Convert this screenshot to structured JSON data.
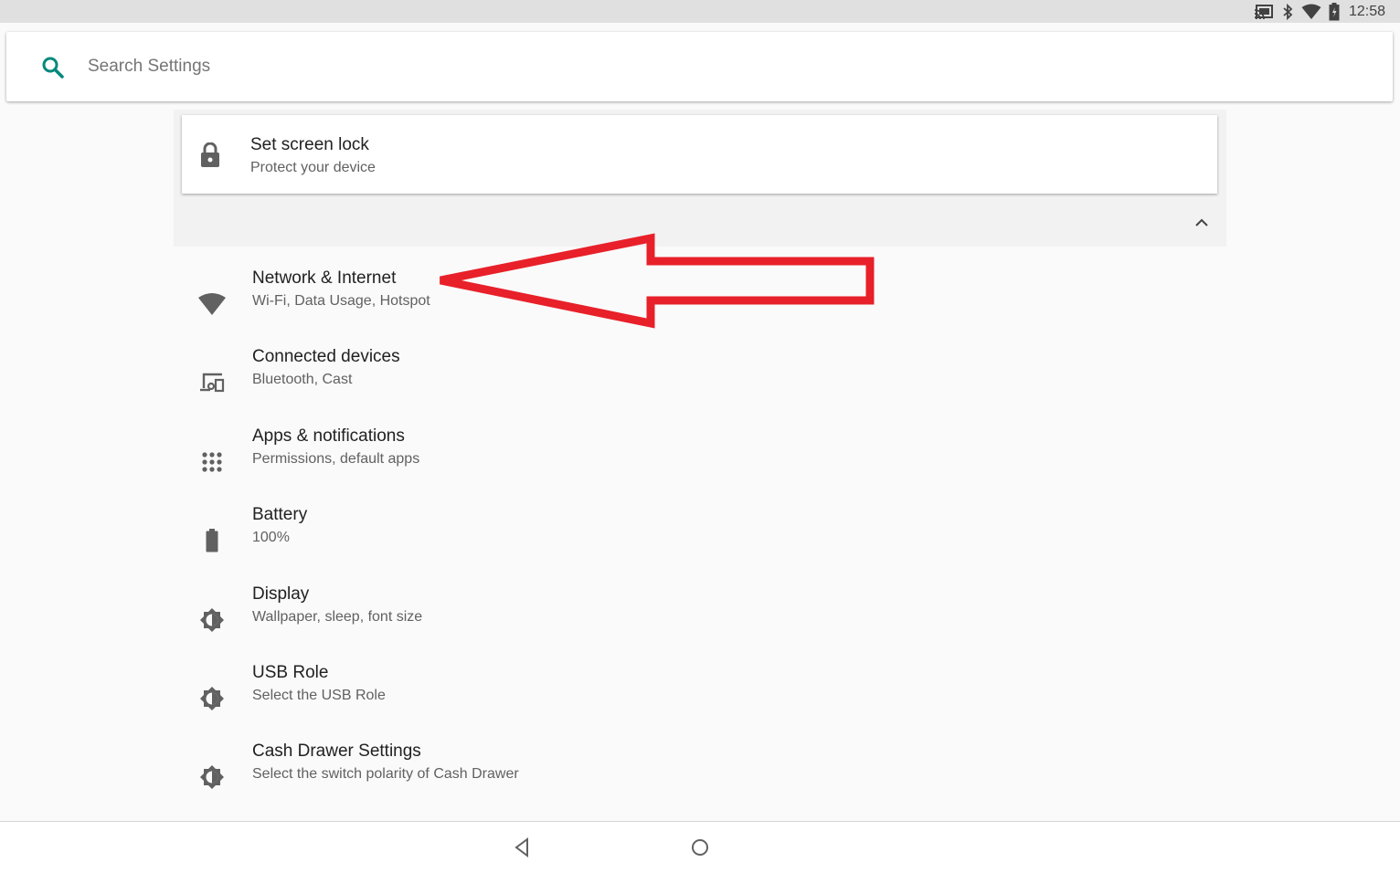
{
  "status_bar": {
    "time": "12:58",
    "icons": [
      "cast-icon",
      "bluetooth-icon",
      "wifi-icon",
      "battery-charging-icon"
    ]
  },
  "search": {
    "placeholder": "Search Settings",
    "icon": "search-icon",
    "accent_color": "#00897b"
  },
  "suggestion": {
    "title": "Set screen lock",
    "summary": "Protect your device",
    "icon": "lock-icon",
    "collapse_icon": "chevron-up-icon"
  },
  "settings": [
    {
      "title": "Network & Internet",
      "summary": "Wi-Fi, Data Usage, Hotspot",
      "icon": "wifi-icon"
    },
    {
      "title": "Connected devices",
      "summary": "Bluetooth, Cast",
      "icon": "devices-icon"
    },
    {
      "title": "Apps & notifications",
      "summary": "Permissions, default apps",
      "icon": "apps-grid-icon"
    },
    {
      "title": "Battery",
      "summary": "100%",
      "icon": "battery-icon"
    },
    {
      "title": "Display",
      "summary": "Wallpaper, sleep, font size",
      "icon": "brightness-icon"
    },
    {
      "title": "USB Role",
      "summary": "Select the USB Role",
      "icon": "brightness-icon"
    },
    {
      "title": "Cash Drawer Settings",
      "summary": "Select the switch polarity of Cash Drawer",
      "icon": "brightness-icon"
    }
  ],
  "annotation": {
    "type": "arrow",
    "points_to": "Network & Internet",
    "color": "#e8202a"
  },
  "nav_bar": {
    "buttons": [
      "back-icon",
      "home-icon"
    ]
  }
}
